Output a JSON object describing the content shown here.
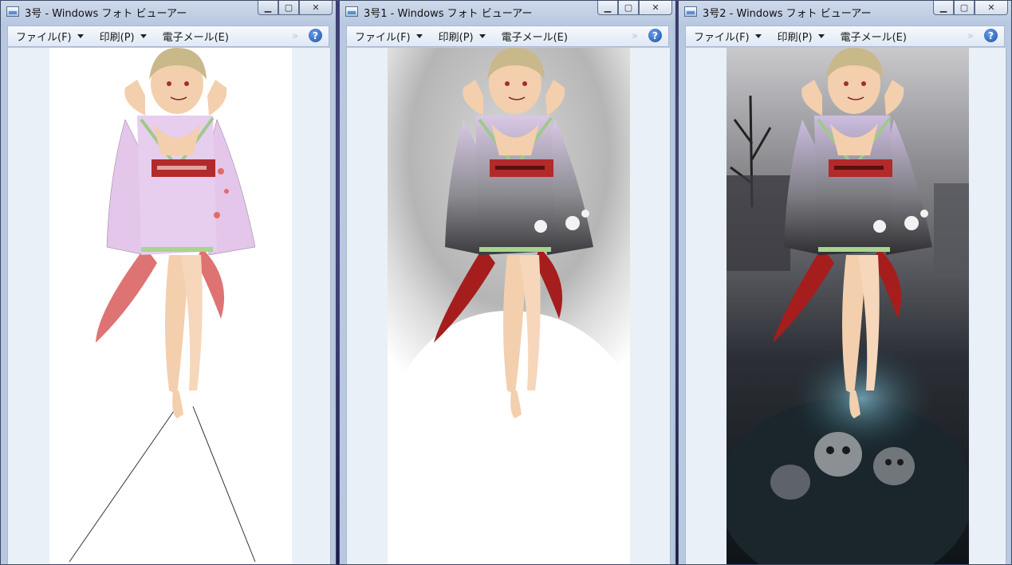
{
  "windows": [
    {
      "title": "3号 - Windows フォト ビューアー",
      "menus": [
        "ファイル(F)",
        "印刷(P)",
        "電子メール(E)"
      ],
      "image": "line-art-white-bg"
    },
    {
      "title": "3号1 - Windows フォト ビューアー",
      "menus": [
        "ファイル(F)",
        "印刷(P)",
        "電子メール(E)"
      ],
      "image": "grey-bg-colored"
    },
    {
      "title": "3号2 - Windows フォト ビューアー",
      "menus": [
        "ファイル(F)",
        "印刷(P)",
        "電子メール(E)"
      ],
      "image": "dark-scene-skulls"
    }
  ],
  "controls": {
    "minimize": "▁",
    "maximize": "▢",
    "close": "✕",
    "more": "»",
    "help": "?"
  },
  "colors": {
    "kimono_pink": "#e3c6ea",
    "obi_red": "#b22a2a",
    "sash_red": "#c8333a",
    "hair": "#c9b88a",
    "skin": "#f3cfae"
  }
}
